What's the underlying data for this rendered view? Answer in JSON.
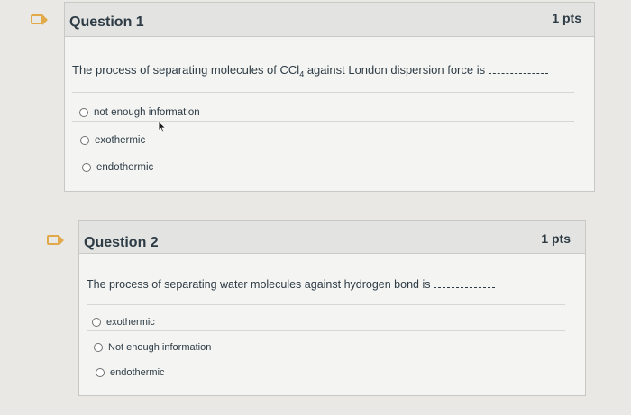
{
  "questions": [
    {
      "title": "Question 1",
      "points": "1 pts",
      "text": "The process of separating molecules of CCl",
      "text_sub": "4",
      "text_tail": " against London dispersion force is",
      "answers": [
        "not enough information",
        "exothermic",
        "endothermic"
      ]
    },
    {
      "title": "Question 2",
      "points": "1 pts",
      "text": "The process of separating water molecules against hydrogen bond is",
      "answers": [
        "exothermic",
        "Not enough information",
        "endothermic"
      ]
    }
  ],
  "icons": {
    "flag": "flag-icon",
    "radio": "radio-icon",
    "cursor": "mouse-pointer-icon"
  },
  "colors": {
    "flag": "#e1a94a",
    "header_bg": "#e3e3e1",
    "card_bg": "#f4f4f2",
    "text": "#2d3b45"
  }
}
